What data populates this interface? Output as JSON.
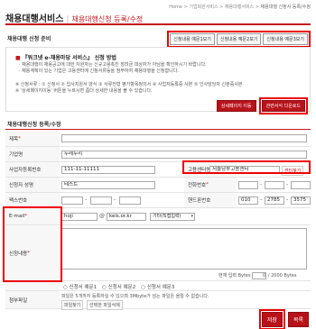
{
  "breadcrumb": [
    "Home",
    "기업회원서비스",
    "채용대행서비스",
    "채용대행 신청서 등록/수정"
  ],
  "page_title": "채용대행서비스",
  "page_subtitle": "채용대행신청 등록/수정",
  "guide": {
    "section_label": "채용대행 신청 준비",
    "example_buttons": [
      "신청내용 예문1보기",
      "신청내용 예문2보기",
      "신청내용 예문3보기"
    ],
    "title_prefix": "『워크넷 e-채용마당 서비스』 신청 방법",
    "line1": "· 채용대행이 채용공고에 대한 지원자는 신규고용촉진 장려금 대상자가 아님을 확인하시기 바랍니다.",
    "line2": "· 채용계획이 있는 기업은 고용센터에 신청서류등을 첨부하여 채용대행을 신청합니다.",
    "note1": "※ 신청서류 : ① 신청서 ② 입사지원서 양식 ③ 서류전형 평가항목정의서 ④ 사업자등록증 사본 ⑤ 인사담당자 신분증사본",
    "note2": "※ '상세페이지이동' 버튼을 누르시면 좀더 상세한 내용을 볼 수 있습니다.",
    "detail_button": "상세페이지 이동",
    "download_button": "관련서식 다운로드"
  },
  "form": {
    "header": "채용대행신청 등록/수정",
    "labels": {
      "title": "제목",
      "company": "기업명",
      "bizno": "사업자등록번호",
      "center": "고용센터명",
      "applicant": "신청자 성명",
      "phone": "전화번호",
      "fax": "팩스번호",
      "mobile": "핸드폰번호",
      "email": "E-mail",
      "content": "신청내용",
      "attach": "첨부파일"
    },
    "values": {
      "title": "",
      "company": "두레누리",
      "bizno": "111-11-11111",
      "center": "서울남부고용센터",
      "applicant": "테스트",
      "phone1": "",
      "phone2": "",
      "phone3": "",
      "fax1": "",
      "fax2": "",
      "fax3": "",
      "mobile1": "010",
      "mobile2": "2785",
      "mobile3": "3575",
      "email_id": "hoji",
      "email_at": "@",
      "email_domain": "keis.or.kr",
      "email_select": "기타(직접입력)"
    },
    "center_button": "센터찾기",
    "counter_label": "현재 입력 Bytes",
    "counter_value": "0",
    "counter_max": "/ 2000 Bytes",
    "radio_options": [
      "신청서 예문1",
      "신청서 예문2",
      "신청서 예문3"
    ],
    "attach_note": "파일은 5개까지 등록하실 수 있으며 3Mbyte가 넘는 파일은 올릴 수 없습니다.",
    "attach_buttons": [
      "파일찾기",
      "선택한 파일삭제"
    ],
    "save_button": "저장",
    "list_button": "목록"
  }
}
